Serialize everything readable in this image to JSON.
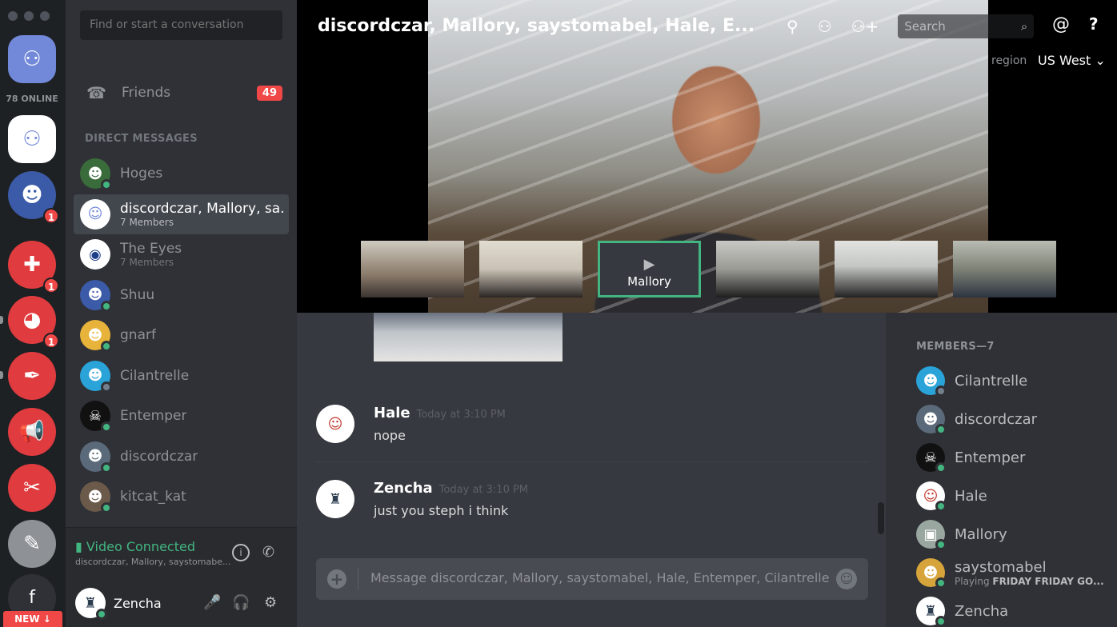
{
  "rail": {
    "online_count": "78 ONLINE",
    "new_label": "NEW ↓",
    "fb_label": "f",
    "servers": [
      {
        "name": "hoges-server-icon",
        "badge": "1"
      },
      {
        "name": "gamepad-server-icon",
        "badge": "1"
      },
      {
        "name": "discord-server-icon",
        "badge": "1"
      },
      {
        "name": "pen-server-icon",
        "badge": ""
      },
      {
        "name": "megaphone-server-icon",
        "badge": ""
      },
      {
        "name": "tools-server-icon",
        "badge": ""
      },
      {
        "name": "sketch-server-icon",
        "badge": ""
      }
    ]
  },
  "dm": {
    "search_placeholder": "Find or start a conversation",
    "friends_label": "Friends",
    "friends_count": "49",
    "section_title": "DIRECT MESSAGES",
    "items": [
      {
        "name": "Hoges",
        "sub": "",
        "status": "on",
        "color": "#3a6b3a",
        "glyph": "☻"
      },
      {
        "name": "discordczar, Mallory, sa...",
        "sub": "7 Members",
        "status": "",
        "color": "#ffffff",
        "glyph": "☺"
      },
      {
        "name": "The Eyes",
        "sub": "7 Members",
        "status": "",
        "color": "#ffffff",
        "glyph": "◉"
      },
      {
        "name": "Shuu",
        "sub": "",
        "status": "on",
        "color": "#3b5aa7",
        "glyph": "☻"
      },
      {
        "name": "gnarf",
        "sub": "",
        "status": "on",
        "color": "#e8b33a",
        "glyph": "☻"
      },
      {
        "name": "Cilantrelle",
        "sub": "",
        "status": "off",
        "color": "#2aa3d8",
        "glyph": "☻"
      },
      {
        "name": "Entemper",
        "sub": "",
        "status": "on",
        "color": "#111111",
        "glyph": "☠"
      },
      {
        "name": "discordczar",
        "sub": "",
        "status": "on",
        "color": "#5b6a7a",
        "glyph": "☻"
      },
      {
        "name": "kitcat_kat",
        "sub": "",
        "status": "on",
        "color": "#6b5a4a",
        "glyph": "☻"
      }
    ],
    "video_status": "Video Connected",
    "video_members": "discordczar, Mallory, saystomabe...",
    "user_name": "Zencha"
  },
  "video": {
    "title": "discordczar, Mallory, saystomabel, Hale, E...",
    "search_placeholder": "Search",
    "region_label": "region",
    "region_value": "US West ⌄",
    "thumbs": [
      {
        "label": "",
        "bg": "#8a7a6a"
      },
      {
        "label": "",
        "bg": "#c9c2b5"
      },
      {
        "label": "Mallory",
        "bg": "#36393f"
      },
      {
        "label": "",
        "bg": "#9a9a95"
      },
      {
        "label": "",
        "bg": "#c4c6c3"
      },
      {
        "label": "",
        "bg": "#7e8276"
      }
    ]
  },
  "messages": [
    {
      "author": "Hale",
      "time": "Today at 3:10 PM",
      "text": "nope",
      "color": "#ffffff",
      "glyph": "☺"
    },
    {
      "author": "Zencha",
      "time": "Today at 3:10 PM",
      "text": "just you steph i think",
      "color": "#ffffff",
      "glyph": "♜"
    }
  ],
  "composer": {
    "placeholder": "Message discordczar, Mallory, saystomabel, Hale, Entemper, Cilantrelle"
  },
  "members": {
    "title": "MEMBERS—7",
    "items": [
      {
        "name": "Cilantrelle",
        "status": "off",
        "color": "#2aa3d8",
        "glyph": "☻",
        "playing": ""
      },
      {
        "name": "discordczar",
        "status": "on",
        "color": "#5b6a7a",
        "glyph": "☻",
        "playing": ""
      },
      {
        "name": "Entemper",
        "status": "on",
        "color": "#111111",
        "glyph": "☠",
        "playing": ""
      },
      {
        "name": "Hale",
        "status": "on",
        "color": "#ffffff",
        "glyph": "☺",
        "playing": ""
      },
      {
        "name": "Mallory",
        "status": "on",
        "color": "#9aa6a0",
        "glyph": "▣",
        "playing": ""
      },
      {
        "name": "saystomabel",
        "status": "on",
        "color": "#d6a43a",
        "glyph": "☻",
        "playing": "FRIDAY FRIDAY GO..."
      },
      {
        "name": "Zencha",
        "status": "on",
        "color": "#ffffff",
        "glyph": "♜",
        "playing": ""
      }
    ],
    "playing_prefix": "Playing"
  }
}
